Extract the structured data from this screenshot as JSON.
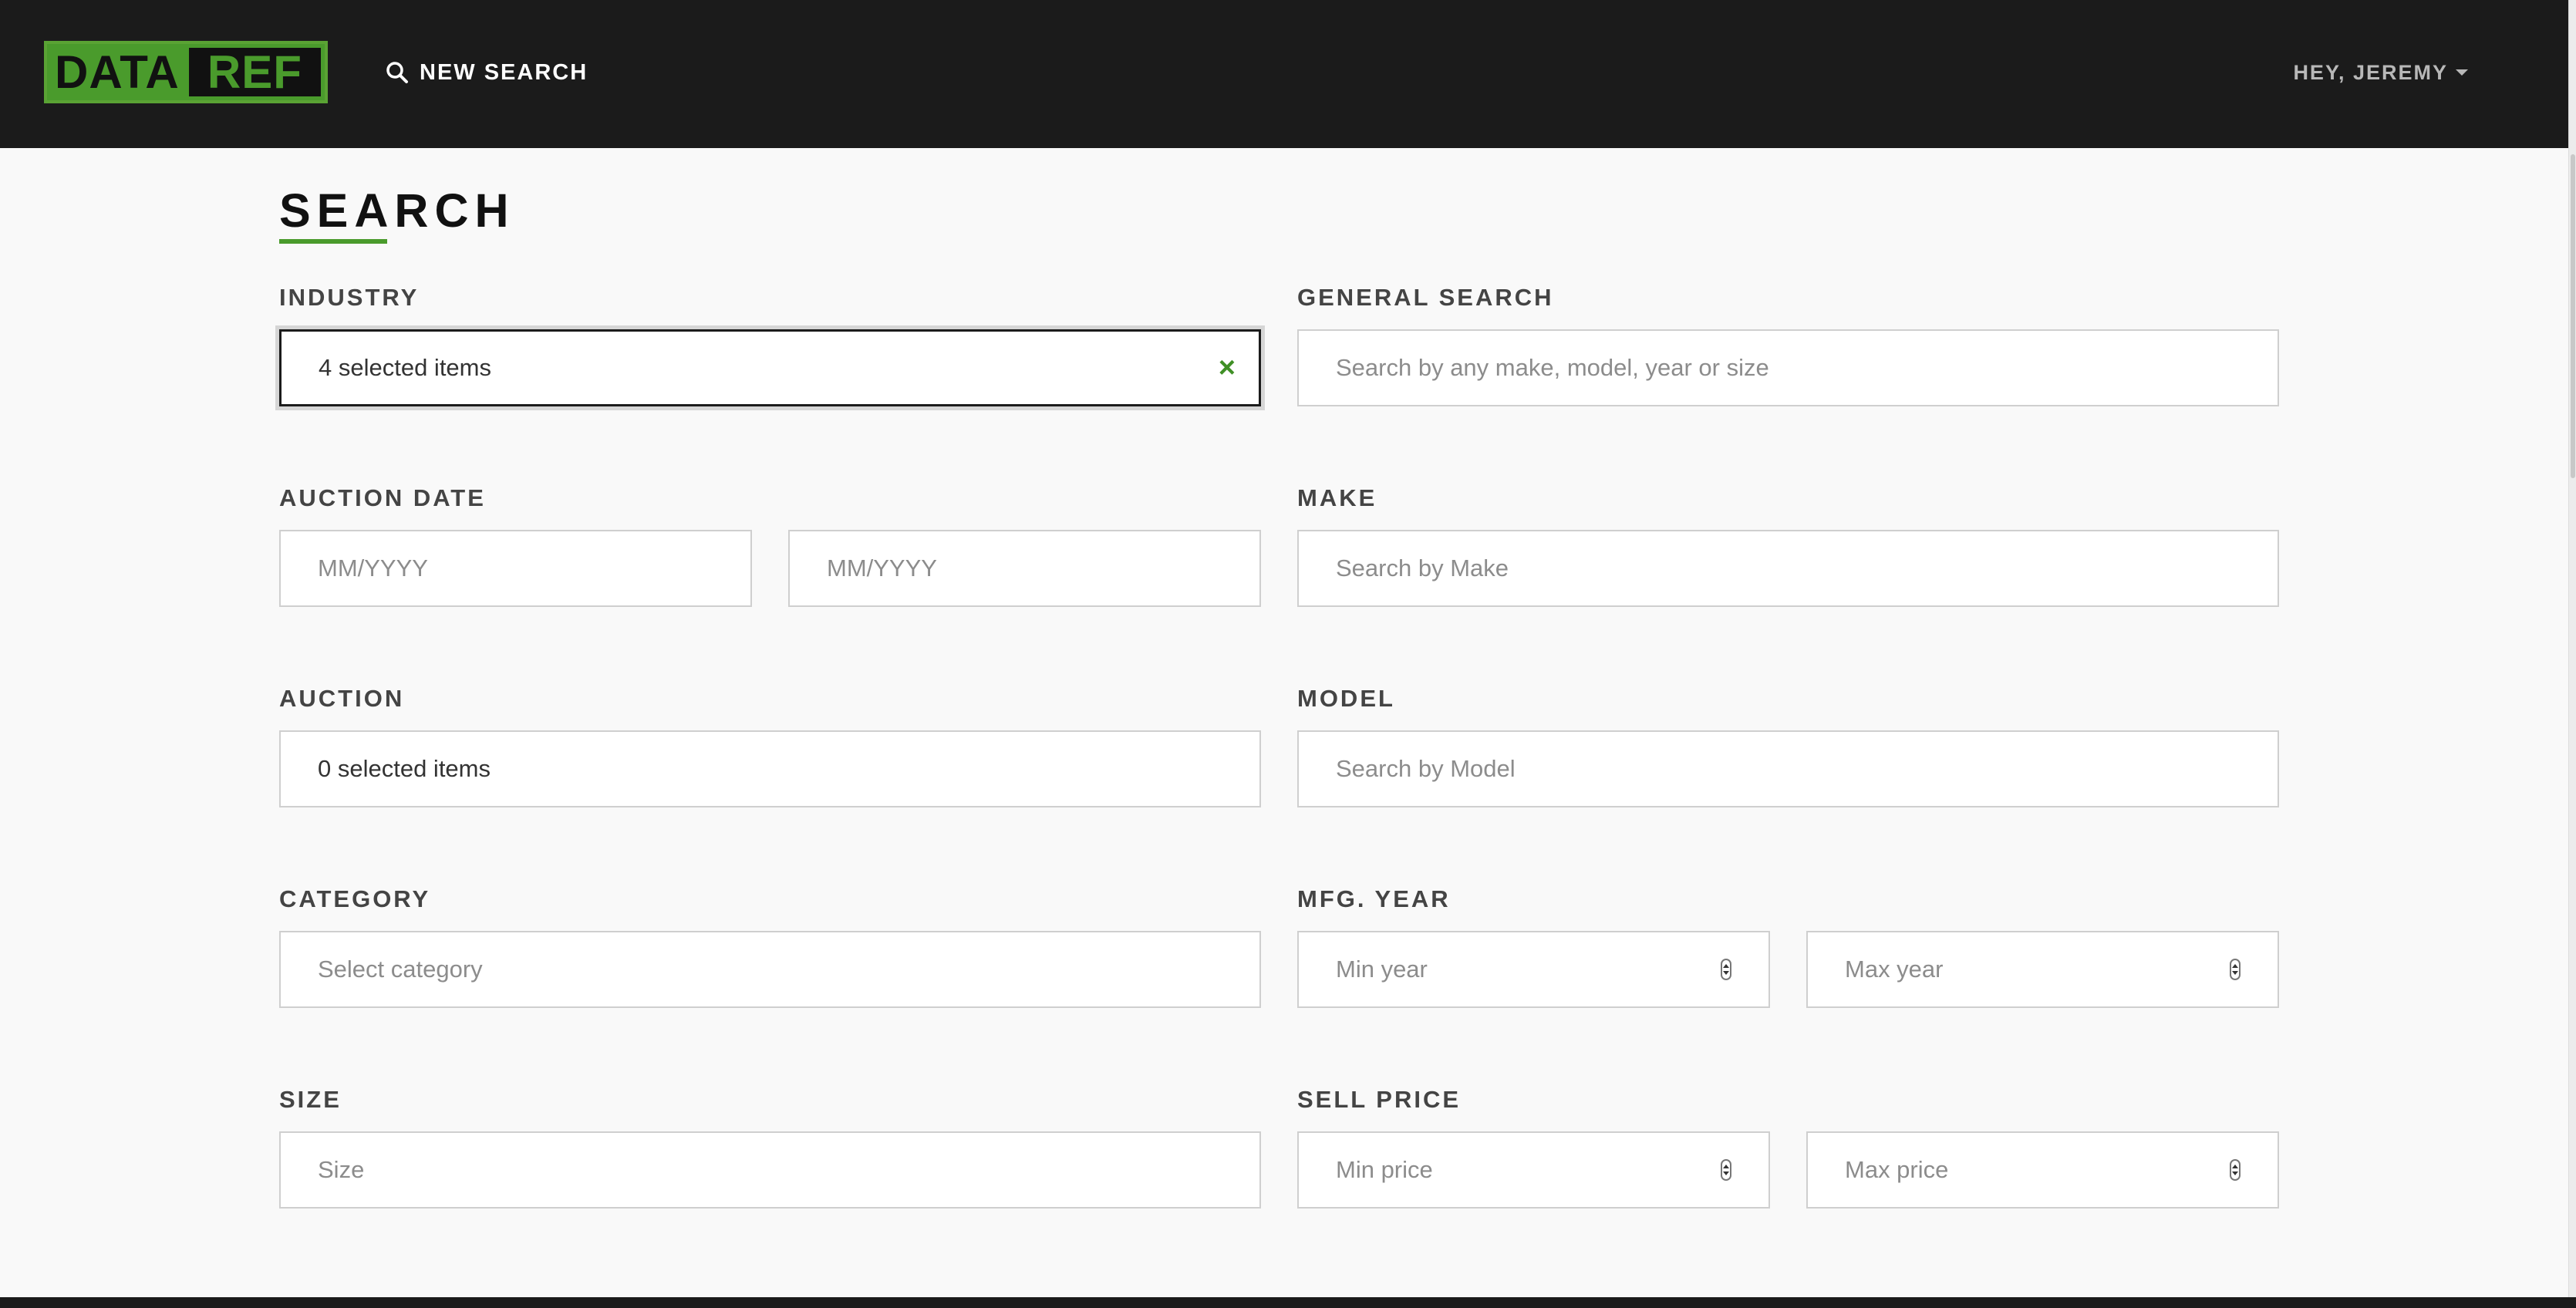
{
  "header": {
    "logo_left": "DATA",
    "logo_right": "REF",
    "new_search_label": "NEW SEARCH",
    "user_greeting": "HEY, JEREMY"
  },
  "main": {
    "title": "SEARCH",
    "industry": {
      "label": "INDUSTRY",
      "value": "4 selected items",
      "clear_icon": "×"
    },
    "general_search": {
      "label": "GENERAL SEARCH",
      "placeholder": "Search by any make, model, year or size"
    },
    "auction_date": {
      "label": "AUCTION DATE",
      "from_placeholder": "MM/YYYY",
      "to_placeholder": "MM/YYYY"
    },
    "make": {
      "label": "MAKE",
      "placeholder": "Search by Make"
    },
    "auction": {
      "label": "AUCTION",
      "value": "0 selected items"
    },
    "model": {
      "label": "MODEL",
      "placeholder": "Search by Model"
    },
    "category": {
      "label": "CATEGORY",
      "placeholder": "Select category"
    },
    "mfg_year": {
      "label": "MFG. YEAR",
      "min_placeholder": "Min year",
      "max_placeholder": "Max year"
    },
    "size": {
      "label": "SIZE",
      "placeholder": "Size"
    },
    "sell_price": {
      "label": "SELL PRICE",
      "min_placeholder": "Min price",
      "max_placeholder": "Max price"
    }
  },
  "colors": {
    "brand_green": "#4a9b2c",
    "nav_background": "#1b1b1b",
    "page_background": "#f9f9f9"
  },
  "icons": {
    "new_search": "search-icon",
    "user_menu": "caret-down-icon",
    "industry_clear": "close-icon",
    "number_inputs": "spinner-icon"
  }
}
